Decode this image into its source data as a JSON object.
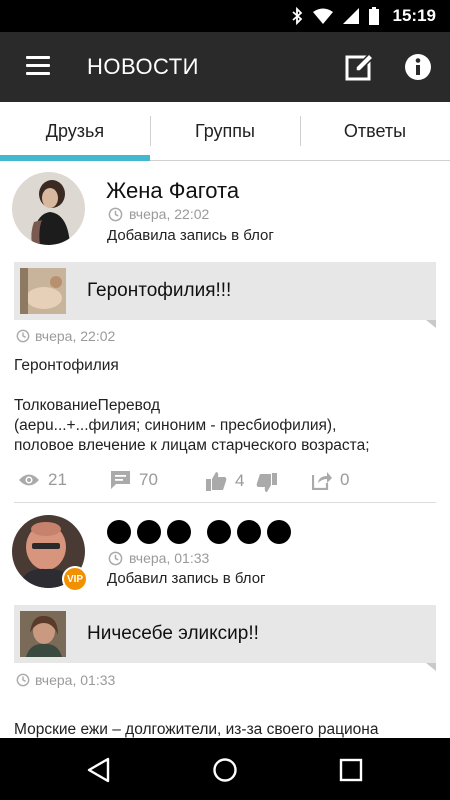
{
  "status_bar": {
    "time": "15:19",
    "icons": [
      "bluetooth-icon",
      "wifi-icon",
      "signal-icon",
      "battery-icon"
    ]
  },
  "app_bar": {
    "title": "НОВОСТИ",
    "icons": [
      "menu-icon",
      "edit-icon",
      "info-icon"
    ]
  },
  "tabs": [
    {
      "label": "Друзья",
      "active": true
    },
    {
      "label": "Группы",
      "active": false
    },
    {
      "label": "Ответы",
      "active": false
    }
  ],
  "posts": [
    {
      "author": "Жена Фагота",
      "time": "вчера, 22:02",
      "action": "Добавила запись в блог",
      "blog_title": "Геронтофилия!!!",
      "post_time": "вчера, 22:02",
      "body": "Геронтофилия\n\nТолкованиеПеревод\n        (aepu...+...филия; синоним - пресбиофилия),\nполовое влечение к лицам старческого возраста;",
      "stats": {
        "views": "21",
        "comments": "70",
        "likes": "4",
        "shares": "0"
      }
    },
    {
      "author": "●●● ●●●",
      "badge": "VIP",
      "time": "вчера, 01:33",
      "action": "Добавил запись в блог",
      "blog_title": "Ничесебе эликсир!!",
      "post_time": "вчера, 01:33",
      "body": "Морские ежи – долгожители, из-за своего рациона"
    }
  ],
  "nav_bar": {
    "icons": [
      "back-icon",
      "home-icon",
      "recents-icon"
    ]
  },
  "colors": {
    "accent": "#42b9cf",
    "app_bar": "#2a2a2a",
    "vip": "#f29100",
    "card": "#e7e7e7"
  }
}
